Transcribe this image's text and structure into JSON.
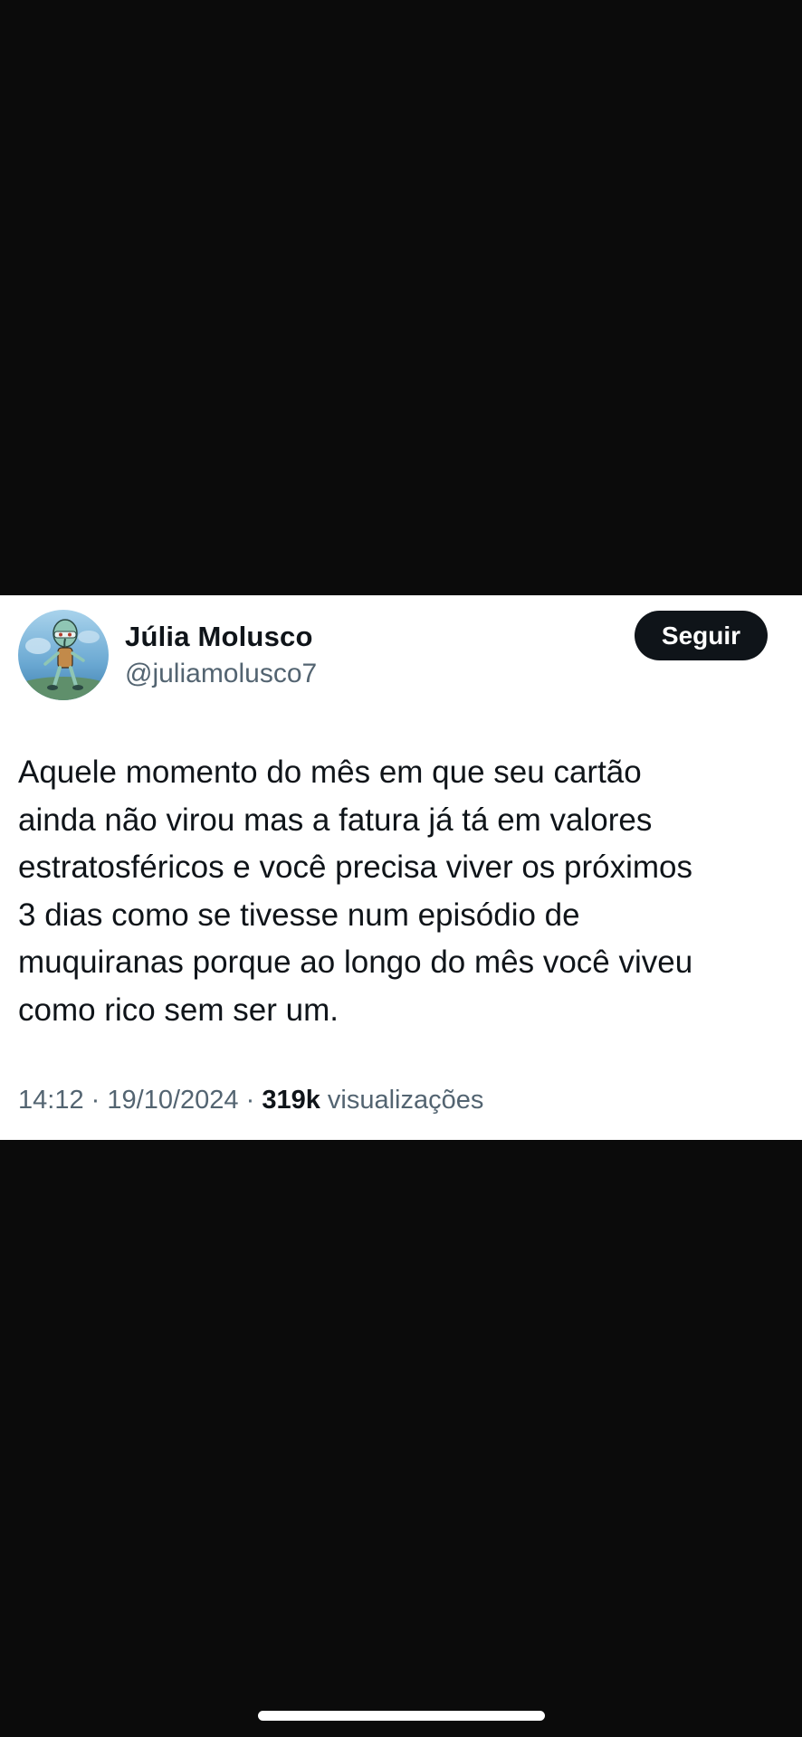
{
  "tweet": {
    "display_name": "Júlia Molusco",
    "handle": "@juliamolusco7",
    "follow_label": "Seguir",
    "text_lines": [
      "Aquele momento do mês em que seu cartão",
      "ainda não virou mas a fatura já tá em valores",
      "estratosféricos e você precisa viver os próximos",
      "3 dias como se tivesse num episódio de",
      "muquiranas porque ao longo do mês você viveu",
      "como rico sem ser um."
    ],
    "time": "14:12",
    "separator": "·",
    "date": "19/10/2024",
    "views_count": "319k",
    "views_label": "visualizações"
  },
  "colors": {
    "background": "#0b0b0b",
    "card": "#ffffff",
    "text_primary": "#0f1419",
    "text_secondary": "#536471",
    "button": "#0f1419"
  },
  "icons": {
    "avatar": "squidward-cartoon-avatar"
  }
}
